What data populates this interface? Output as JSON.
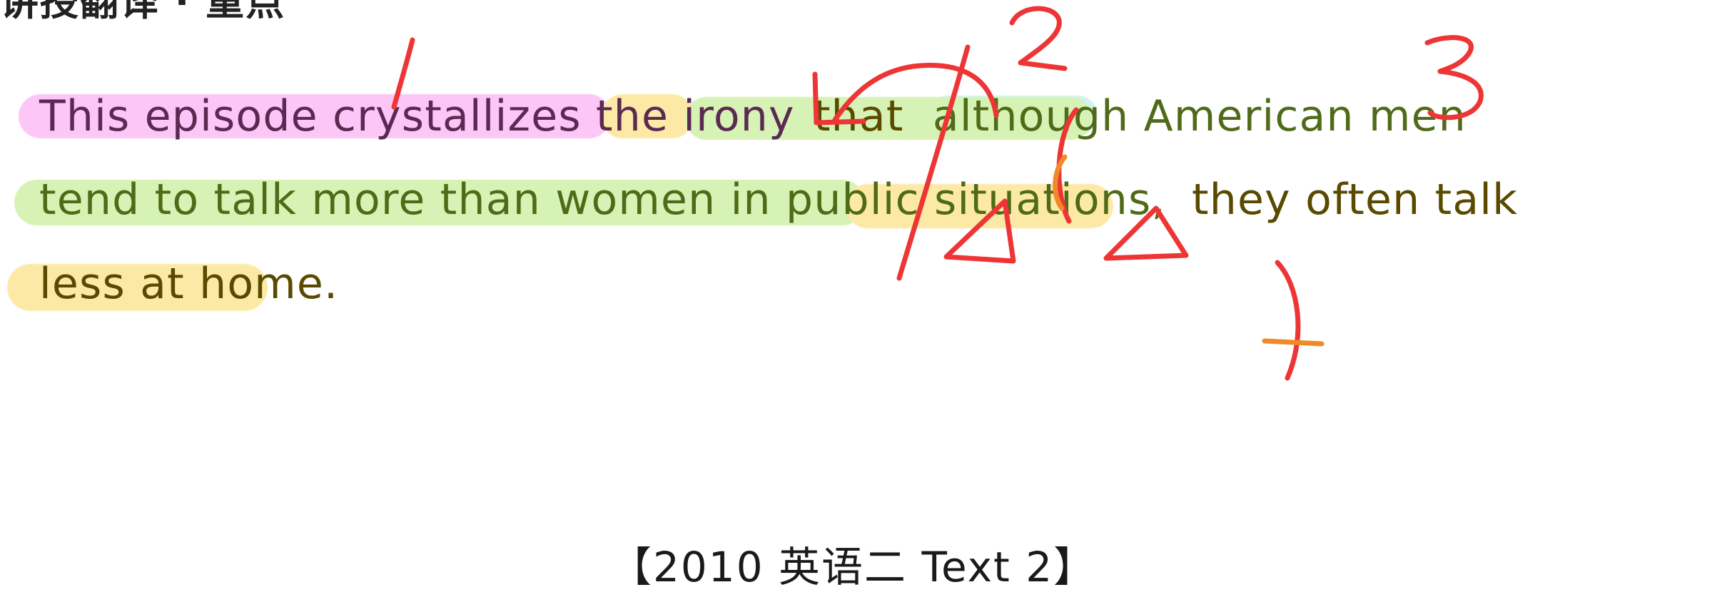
{
  "header_fragment": "讲授翻译 · 重点",
  "sentence": {
    "line1": {
      "main_clause": "This episode crystallizes the irony",
      "connector": "that",
      "concession_clause": "although American men"
    },
    "line2": {
      "concession_clause_cont": "tend to talk more than women in public situations,",
      "content_clause": "they often talk"
    },
    "line3": {
      "content_clause_cont": "less at home."
    }
  },
  "annotations": {
    "numbers": [
      "1",
      "2",
      "3"
    ]
  },
  "footer": {
    "source": "【2010 英语二 Text 2】"
  },
  "colors": {
    "main_clause_highlight": "#fcc6f7",
    "connector_highlight": "#fde9a6",
    "concession_highlight": "#d6f2b4",
    "content_highlight": "#fde9a6",
    "ink": "#ee3535"
  }
}
